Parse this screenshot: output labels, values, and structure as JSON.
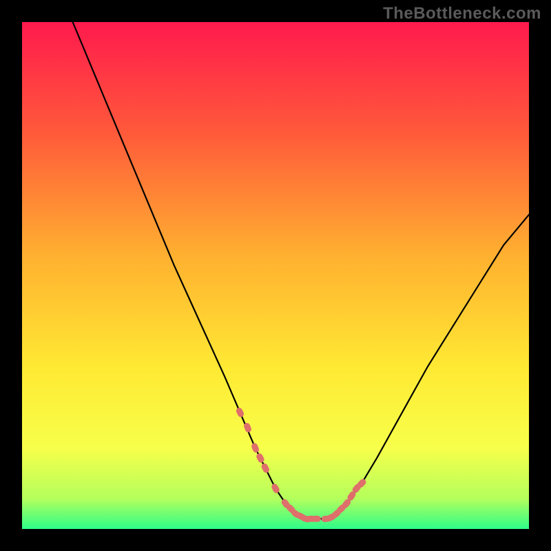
{
  "watermark": "TheBottleneck.com",
  "colors": {
    "bg_black": "#000000",
    "grad_top": "#ff1a4d",
    "grad_mid1": "#ff5a3a",
    "grad_mid2": "#ffb030",
    "grad_mid3": "#ffe933",
    "grad_mid4": "#f7ff4a",
    "grad_low": "#b4ff5c",
    "grad_base": "#2dfd89",
    "curve": "#000000",
    "marker": "#de6f6b"
  },
  "chart_data": {
    "type": "line",
    "title": "",
    "xlabel": "",
    "ylabel": "",
    "xlim": [
      0,
      100
    ],
    "ylim": [
      0,
      100
    ],
    "series": [
      {
        "name": "curve",
        "x": [
          10,
          15,
          20,
          25,
          30,
          35,
          40,
          43,
          46,
          48,
          50,
          52,
          54,
          56,
          58,
          60,
          62,
          64,
          67,
          70,
          75,
          80,
          85,
          90,
          95,
          100
        ],
        "y": [
          100,
          88,
          76,
          64,
          52,
          41,
          30,
          23,
          16,
          12,
          8,
          5,
          3,
          2,
          2,
          2,
          3,
          5,
          9,
          14,
          23,
          32,
          40,
          48,
          56,
          62
        ]
      }
    ],
    "markers": {
      "name": "highlighted-points",
      "x": [
        43,
        44.5,
        46,
        47,
        48,
        50,
        52,
        53,
        54,
        55,
        56,
        57,
        58,
        60,
        61,
        62,
        63,
        64,
        65,
        66,
        67
      ],
      "y": [
        23,
        20,
        16,
        14,
        12,
        8,
        5,
        4,
        3,
        2.5,
        2,
        2,
        2,
        2,
        2.3,
        3,
        4,
        5,
        6.5,
        8,
        9
      ]
    }
  }
}
